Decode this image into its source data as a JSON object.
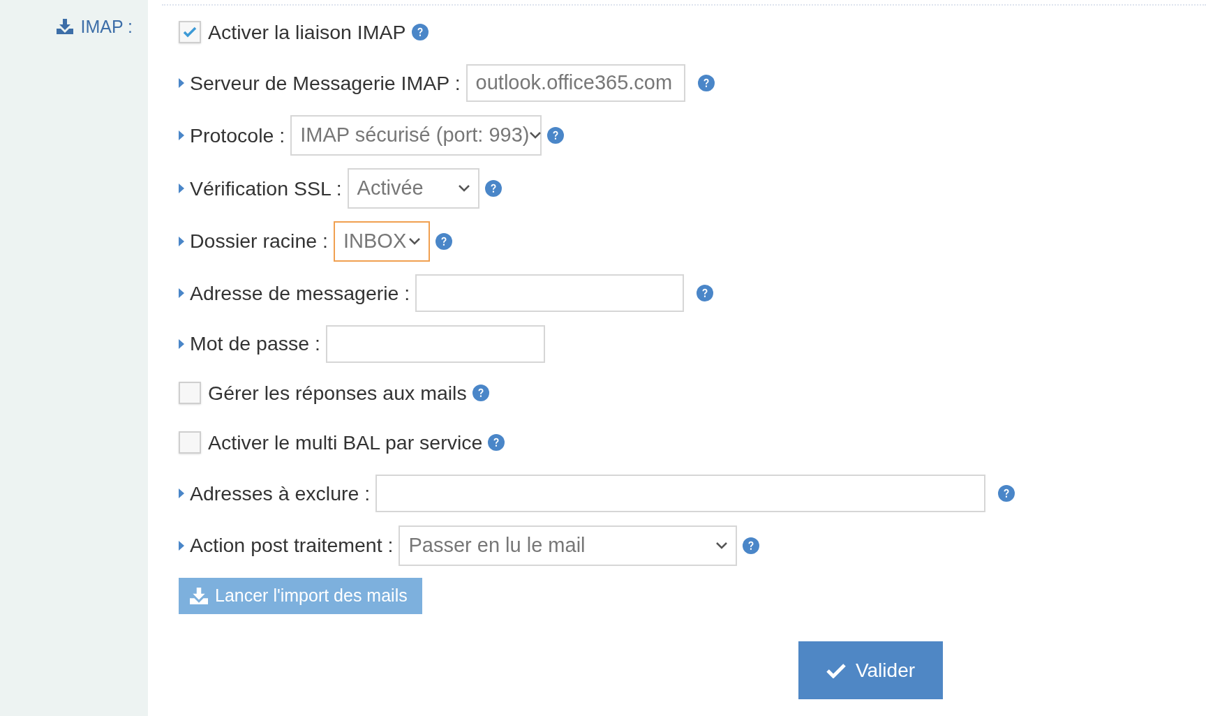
{
  "sidebar": {
    "label": "IMAP :"
  },
  "rows": [
    {
      "kind": "checkbox",
      "label": "Activer la liaison IMAP",
      "checked": true,
      "help": true
    },
    {
      "kind": "input",
      "label": "Serveur de Messagerie IMAP :",
      "value": "outlook.office365.com",
      "focused": false,
      "help": true
    },
    {
      "kind": "select",
      "label": "Protocole :",
      "value": "IMAP sécurisé (port: 993)",
      "focused": false,
      "help": true
    },
    {
      "kind": "select",
      "label": "Vérification SSL :",
      "value": "Activée",
      "focused": false,
      "help": true
    },
    {
      "kind": "select",
      "label": "Dossier racine :",
      "value": "INBOX",
      "focused": true,
      "help": true
    },
    {
      "kind": "input",
      "label": "Adresse de messagerie :",
      "focused": false,
      "help": true
    },
    {
      "kind": "input",
      "label": "Mot de passe :",
      "focused": false,
      "help": false
    },
    {
      "kind": "checkbox",
      "label": "Gérer les réponses aux mails",
      "checked": false,
      "help": true
    },
    {
      "kind": "checkbox",
      "label": "Activer le multi BAL par service",
      "checked": false,
      "help": true
    },
    {
      "kind": "input",
      "label": "Adresses à exclure :",
      "focused": false,
      "help": true
    },
    {
      "kind": "select",
      "label": "Action post traitement :",
      "value": "Passer en lu le mail",
      "focused": false,
      "help": true
    }
  ],
  "import_button": "Lancer l'import des mails",
  "submit_button": "Valider"
}
